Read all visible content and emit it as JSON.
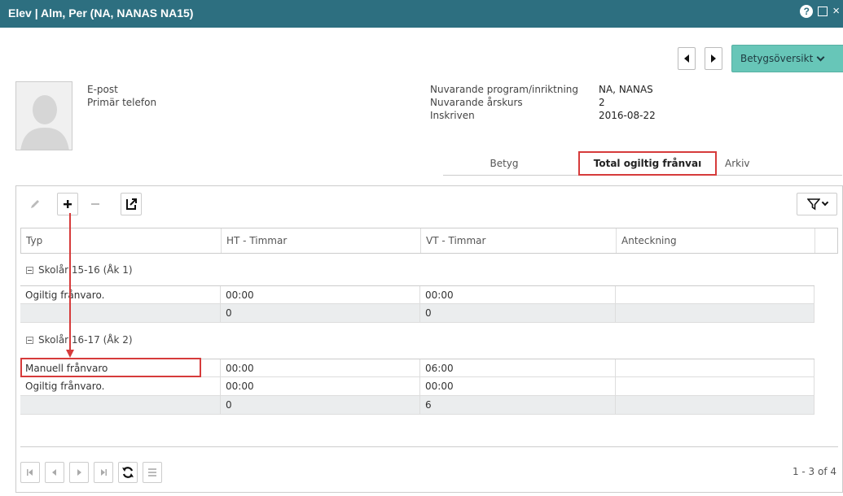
{
  "window": {
    "title": "Elev | Alm, Per (NA, NANAS NA15)",
    "help_glyph": "?",
    "close_glyph": "×"
  },
  "header": {
    "overview_button": "Betygsöversikt"
  },
  "student": {
    "email_label": "E-post",
    "phone_label": "Primär telefon",
    "program_label": "Nuvarande program/inriktning",
    "program_value": "NA, NANAS",
    "year_label": "Nuvarande årskurs",
    "year_value": "2",
    "enrolled_label": "Inskriven",
    "enrolled_value": "2016-08-22"
  },
  "tabs": [
    {
      "label": "Betyg"
    },
    {
      "label": "Total ogiltig frånvaı"
    },
    {
      "label": "Arkiv"
    }
  ],
  "grid": {
    "columns": [
      "Typ",
      "HT - Timmar",
      "VT - Timmar",
      "Anteckning"
    ],
    "groups": [
      {
        "label": "Skolår 15-16 (Åk 1)",
        "rows": [
          {
            "typ": "Ogiltig frånvaro.",
            "ht": "00:00",
            "vt": "00:00",
            "note": ""
          }
        ],
        "sum": {
          "ht": "0",
          "vt": "0"
        }
      },
      {
        "label": "Skolår 16-17 (Åk 2)",
        "rows": [
          {
            "typ": "Manuell frånvaro",
            "ht": "00:00",
            "vt": "06:00",
            "note": ""
          },
          {
            "typ": "Ogiltig frånvaro.",
            "ht": "00:00",
            "vt": "00:00",
            "note": ""
          }
        ],
        "sum": {
          "ht": "0",
          "vt": "6"
        }
      }
    ]
  },
  "pager": {
    "info": "1 - 3 of 4"
  },
  "colors": {
    "titlebar": "#2d6f80",
    "accent_button": "#67c6b8",
    "highlight": "#d63b3b"
  }
}
